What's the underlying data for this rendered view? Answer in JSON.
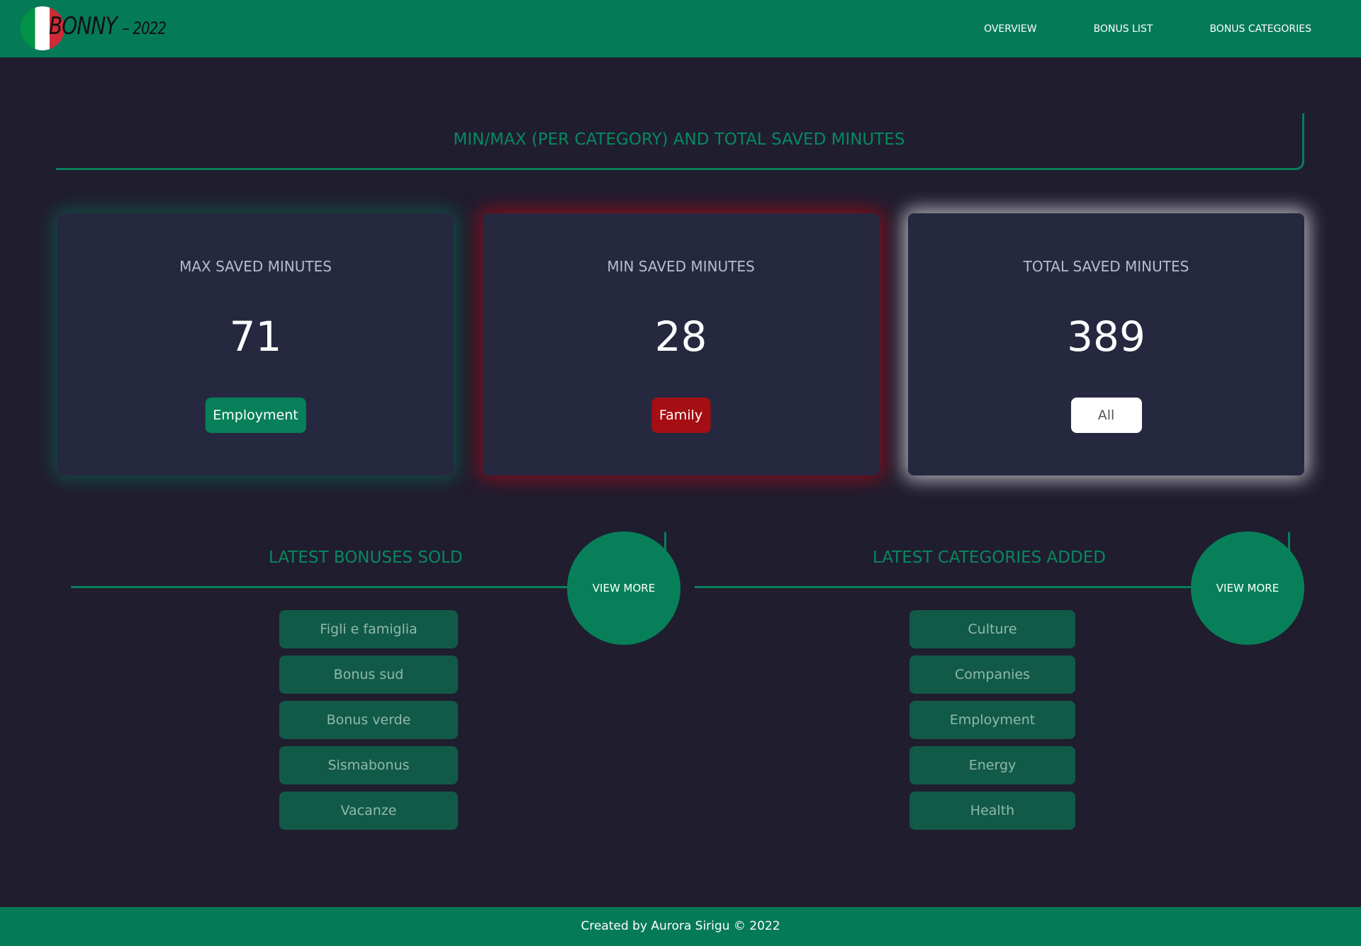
{
  "header": {
    "logo_text": "BONNY",
    "logo_year": "– 2022",
    "nav": [
      "OVERVIEW",
      "BONUS LIST",
      "BONUS CATEGORIES"
    ]
  },
  "section_title": "MIN/MAX (PER CATEGORY) AND TOTAL SAVED MINUTES",
  "cards": [
    {
      "label": "MAX SAVED MINUTES",
      "value": "71",
      "badge": "Employment"
    },
    {
      "label": "MIN SAVED MINUTES",
      "value": "28",
      "badge": "Family"
    },
    {
      "label": "TOTAL SAVED MINUTES",
      "value": "389",
      "badge": "All"
    }
  ],
  "latest_bonuses": {
    "title": "LATEST BONUSES SOLD",
    "view_more": "VIEW MORE",
    "items": [
      "Figli e famiglia",
      "Bonus sud",
      "Bonus verde",
      "Sismabonus",
      "Vacanze"
    ]
  },
  "latest_categories": {
    "title": "LATEST CATEGORIES ADDED",
    "view_more": "VIEW MORE",
    "items": [
      "Culture",
      "Companies",
      "Employment",
      "Energy",
      "Health"
    ]
  },
  "footer": "Created by Aurora Sirigu © 2022",
  "colors": {
    "primary_green": "#057a57",
    "background": "#201d2f",
    "card_background": "#262840",
    "danger_red": "#a50e12"
  }
}
